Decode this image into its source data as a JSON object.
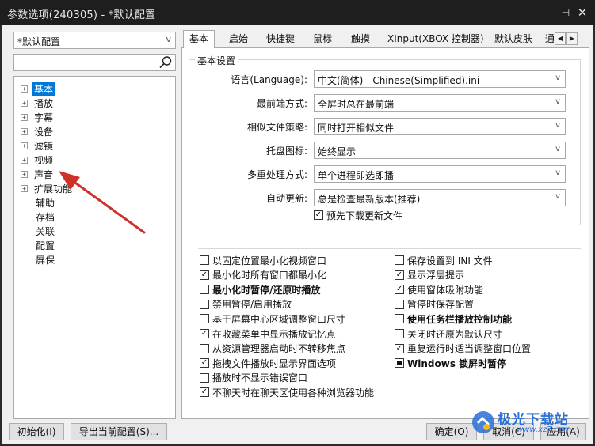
{
  "window": {
    "title": "参数选项(240305) - *默认配置",
    "pin_glyph": "⊣",
    "close_glyph": "✕"
  },
  "left": {
    "profile": "*默认配置",
    "search_value": "",
    "tree_expandable": [
      {
        "label": "基本",
        "selected": true
      },
      {
        "label": "播放"
      },
      {
        "label": "字幕"
      },
      {
        "label": "设备"
      },
      {
        "label": "滤镜"
      },
      {
        "label": "视频"
      },
      {
        "label": "声音"
      },
      {
        "label": "扩展功能"
      }
    ],
    "tree_leaves": [
      "辅助",
      "存档",
      "关联",
      "配置",
      "屏保"
    ],
    "expand_glyph": "+"
  },
  "tabs": [
    "基本",
    "启始",
    "快捷键",
    "鼠标",
    "触摸",
    "XInput(XBOX 控制器)",
    "默认皮肤",
    "通"
  ],
  "tab_scroll": {
    "left": "◀",
    "right": "▶"
  },
  "basic": {
    "group_title": "基本设置",
    "rows": [
      {
        "label": "语言(Language):",
        "value": "中文(简体) - Chinese(Simplified).ini"
      },
      {
        "label": "最前端方式:",
        "value": "全屏时总在最前端"
      },
      {
        "label": "相似文件策略:",
        "value": "同时打开相似文件"
      },
      {
        "label": "托盘图标:",
        "value": "始终显示"
      },
      {
        "label": "多重处理方式:",
        "value": "单个进程即选即播"
      },
      {
        "label": "自动更新:",
        "value": "总是检查最新版本(推荐)"
      }
    ],
    "combo_arrow": "v",
    "predownload": {
      "label": "预先下载更新文件",
      "checked": true
    }
  },
  "options_left": [
    {
      "label": "以固定位置最小化视频窗口",
      "state": "unchecked"
    },
    {
      "label": "最小化时所有窗口都最小化",
      "state": "checked"
    },
    {
      "label": "最小化时暂停/还原时播放",
      "state": "unchecked",
      "bold": true
    },
    {
      "label": "禁用暂停/启用播放",
      "state": "unchecked"
    },
    {
      "label": "基于屏幕中心区域调整窗口尺寸",
      "state": "unchecked"
    },
    {
      "label": "在收藏菜单中显示播放记忆点",
      "state": "checked"
    },
    {
      "label": "从资源管理器启动时不转移焦点",
      "state": "unchecked"
    },
    {
      "label": "拖拽文件播放时显示界面选项",
      "state": "checked"
    },
    {
      "label": "播放时不显示错误窗口",
      "state": "unchecked"
    },
    {
      "label": "不聊天时在聊天区使用各种浏览器功能",
      "state": "checked"
    }
  ],
  "options_right": [
    {
      "label": "保存设置到 INI 文件",
      "state": "unchecked"
    },
    {
      "label": "显示浮层提示",
      "state": "checked"
    },
    {
      "label": "使用窗体吸附功能",
      "state": "checked"
    },
    {
      "label": "暂停时保存配置",
      "state": "unchecked"
    },
    {
      "label": "使用任务栏播放控制功能",
      "state": "unchecked",
      "bold": true
    },
    {
      "label": "关闭时还原为默认尺寸",
      "state": "unchecked"
    },
    {
      "label": "重复运行时适当调整窗口位置",
      "state": "checked"
    },
    {
      "label": "Windows 锁屏时暂停",
      "state": "indeterminate",
      "bold": true
    }
  ],
  "buttons": {
    "init": "初始化(I)",
    "export": "导出当前配置(S)...",
    "ok": "确定(O)",
    "cancel": "取消(C)",
    "apply": "应用(A)"
  },
  "watermark": {
    "text": "极光下载站",
    "url": "www.xz7.com"
  },
  "colors": {
    "selection": "#0078d7",
    "annotation_arrow": "#d0302a",
    "watermark": "#2a6fd6"
  }
}
